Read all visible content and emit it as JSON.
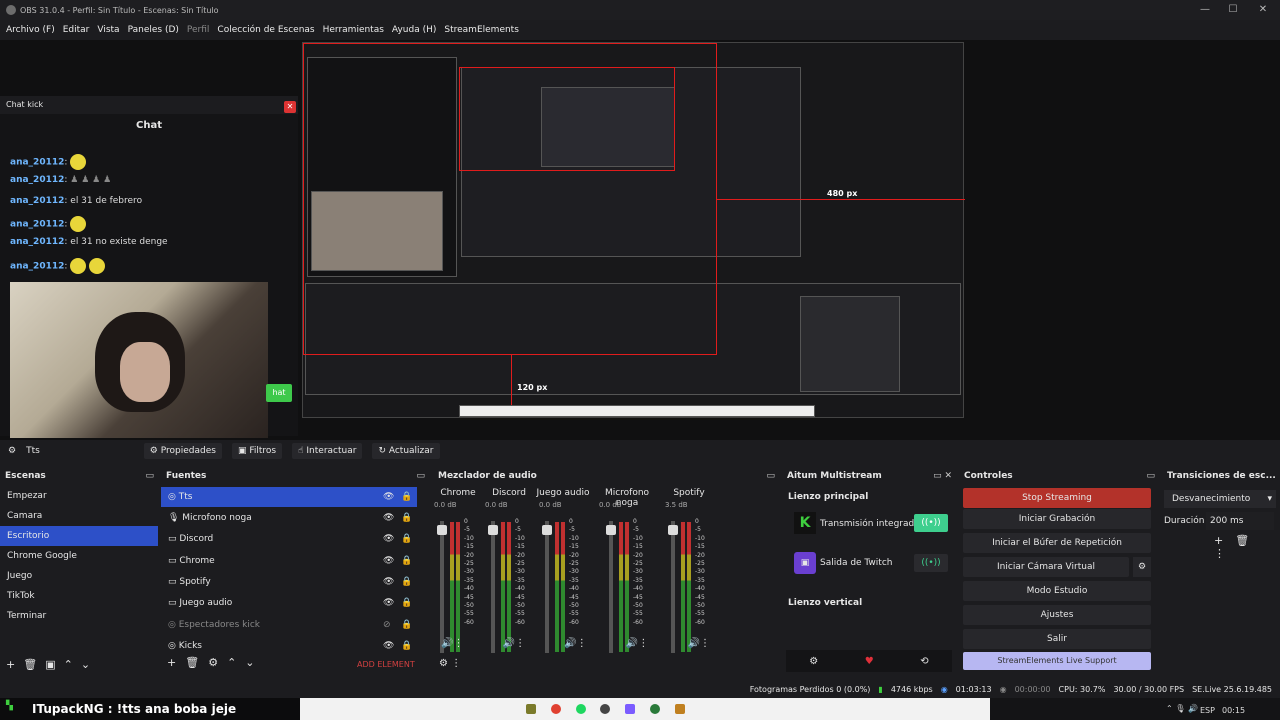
{
  "window": {
    "title": "OBS 31.0.4 - Perfil: Sin Título - Escenas: Sin Título",
    "minimize": "—",
    "maximize": "☐",
    "close": "✕"
  },
  "menu": [
    {
      "label": "Archivo (F)"
    },
    {
      "label": "Editar"
    },
    {
      "label": "Vista"
    },
    {
      "label": "Paneles (D)"
    },
    {
      "label": "Perfil"
    },
    {
      "label": "Colección de Escenas"
    },
    {
      "label": "Herramientas"
    },
    {
      "label": "Ayuda (H)"
    },
    {
      "label": "StreamElements"
    }
  ],
  "chat": {
    "dock_title": "Chat kick",
    "title": "Chat",
    "lines": [
      {
        "user": "ana_20112",
        "text": ""
      },
      {
        "user": "ana_20112",
        "text": ""
      },
      {
        "user": "ana_20112",
        "text": "el 31 de febrero"
      },
      {
        "user": "ana_20112",
        "text": ""
      },
      {
        "user": "ana_20112",
        "text": "el 31 no existe denge"
      },
      {
        "user": "ana_20112",
        "text": ""
      }
    ],
    "button": "hat"
  },
  "preview": {
    "label_480": "480 px",
    "label_120": "120 px"
  },
  "source_bar": {
    "selected_source": "Tts",
    "buttons": [
      {
        "label": "Propiedades"
      },
      {
        "label": "Filtros"
      },
      {
        "label": "Interactuar"
      },
      {
        "label": "Actualizar"
      }
    ]
  },
  "scenes": {
    "title": "Escenas",
    "items": [
      {
        "label": "Empezar"
      },
      {
        "label": "Camara"
      },
      {
        "label": "Escritorio"
      },
      {
        "label": "Chrome Google"
      },
      {
        "label": "Juego"
      },
      {
        "label": "TikTok"
      },
      {
        "label": "Terminar"
      }
    ]
  },
  "sources": {
    "title": "Fuentes",
    "items": [
      {
        "label": "Tts"
      },
      {
        "label": "Microfono noga"
      },
      {
        "label": "Discord"
      },
      {
        "label": "Chrome"
      },
      {
        "label": "Spotify"
      },
      {
        "label": "Juego audio"
      },
      {
        "label": "Espectadores kick"
      },
      {
        "label": "Kicks"
      }
    ],
    "add_element": "ADD ELEMENT"
  },
  "mixer": {
    "title": "Mezclador de audio",
    "channels": [
      {
        "name": "Chrome",
        "db": "0.0 dB"
      },
      {
        "name": "Discord",
        "db": "0.0 dB"
      },
      {
        "name": "Juego audio",
        "db": "0.0 dB"
      },
      {
        "name": "Microfono noga",
        "db": "0.0 dB"
      },
      {
        "name": "Spotify",
        "db": "3.5 dB"
      }
    ],
    "ticks": [
      "0",
      "-5",
      "-10",
      "-15",
      "-20",
      "-25",
      "-30",
      "-35",
      "-40",
      "-45",
      "-50",
      "-55",
      "-60"
    ]
  },
  "multistream": {
    "title": "Aitum Multistream",
    "main_label": "Lienzo principal",
    "outputs": [
      {
        "label": "Transmisión integrada"
      },
      {
        "label": "Salida de Twitch"
      }
    ],
    "vertical_label": "Lienzo vertical"
  },
  "controls": {
    "title": "Controles",
    "buttons": [
      {
        "label": "Stop Streaming"
      },
      {
        "label": "Iniciar Grabación"
      },
      {
        "label": "Iniciar el Búfer de Repetición"
      },
      {
        "label": "Iniciar Cámara Virtual"
      },
      {
        "label": "Modo Estudio"
      },
      {
        "label": "Ajustes"
      },
      {
        "label": "Salir"
      },
      {
        "label": "StreamElements Live Support"
      }
    ]
  },
  "transitions": {
    "title": "Transiciones de esc...",
    "selected": "Desvanecimiento",
    "duration_label": "Duración",
    "duration_value": "200 ms"
  },
  "status": {
    "dropped": "Fotogramas Perdidos 0 (0.0%)",
    "bitrate": "4746 kbps",
    "live_time": "01:03:13",
    "rec_time": "00:00:00",
    "cpu": "CPU: 30.7%",
    "fps": "30.00 / 30.00 FPS",
    "version": "SE.Live 25.6.19.485"
  },
  "ticker": "ITupackNG : !tts ana boba jeje",
  "taskbar": {
    "lang": "ESP",
    "time": "00:15"
  }
}
